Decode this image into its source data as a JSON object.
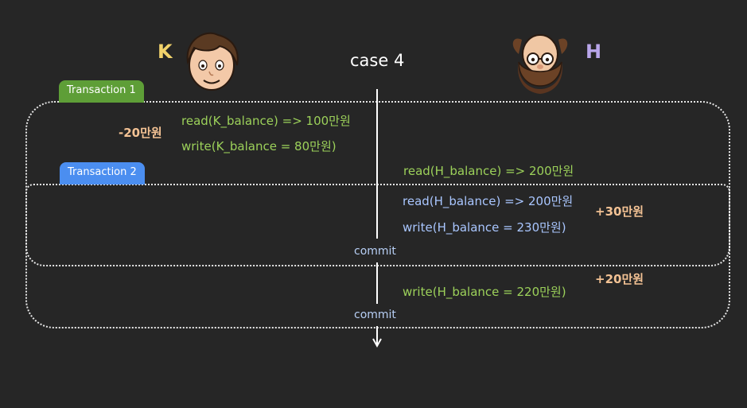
{
  "title": "case 4",
  "actors": {
    "k": {
      "letter": "K",
      "color": "#f2d36b"
    },
    "h": {
      "letter": "H",
      "color": "#b9a6ea"
    }
  },
  "transactions": [
    {
      "label": "Transaction 1",
      "color": "#5e9e37"
    },
    {
      "label": "Transaction 2",
      "color": "#4b8ef0"
    }
  ],
  "ops": {
    "t1_read_k": "read(K_balance) => 100만원",
    "t1_write_k": "write(K_balance = 80만원)",
    "t1_read_h": "read(H_balance) => 200만원",
    "t2_read_h": "read(H_balance) => 200만원",
    "t2_write_h": "write(H_balance = 230만원)",
    "t1_write_h": "write(H_balance = 220만원)"
  },
  "deltas": {
    "k_minus": "-20만원",
    "h_plus30": "+30만원",
    "h_plus20": "+20만원"
  },
  "commits": {
    "t2": "commit",
    "t1": "commit"
  },
  "colors": {
    "background": "#262626",
    "op_green": "#9cd15a",
    "op_blue": "#a9c6ff",
    "delta": "#f3c294"
  }
}
